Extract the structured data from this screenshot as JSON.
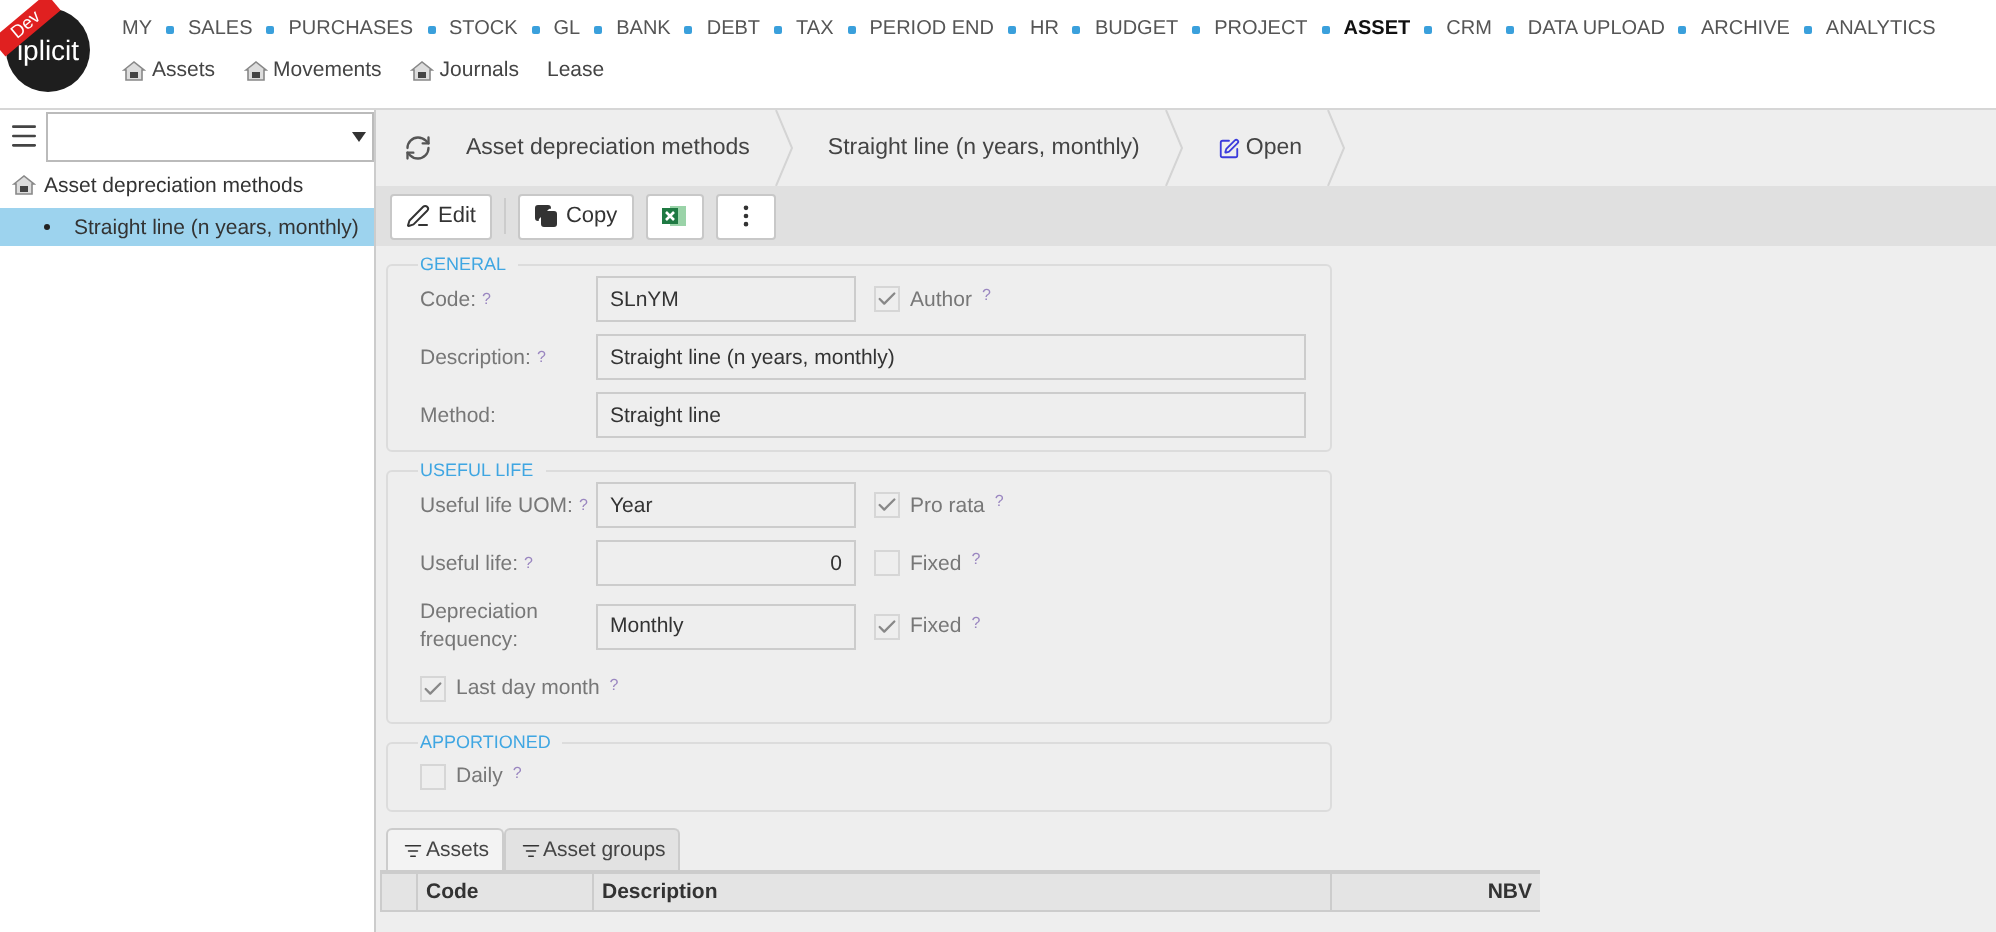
{
  "header": {
    "badge": "Dev",
    "logo": "iplicit",
    "modules": [
      {
        "label": "MY",
        "selected": false
      },
      {
        "label": "SALES",
        "selected": false
      },
      {
        "label": "PURCHASES",
        "selected": false
      },
      {
        "label": "STOCK",
        "selected": false
      },
      {
        "label": "GL",
        "selected": false
      },
      {
        "label": "BANK",
        "selected": false
      },
      {
        "label": "DEBT",
        "selected": false
      },
      {
        "label": "TAX",
        "selected": false
      },
      {
        "label": "PERIOD END",
        "selected": false
      },
      {
        "label": "HR",
        "selected": false
      },
      {
        "label": "BUDGET",
        "selected": false
      },
      {
        "label": "PROJECT",
        "selected": false
      },
      {
        "label": "ASSET",
        "selected": true
      },
      {
        "label": "CRM",
        "selected": false
      },
      {
        "label": "DATA UPLOAD",
        "selected": false
      },
      {
        "label": "ARCHIVE",
        "selected": false
      },
      {
        "label": "ANALYTICS",
        "selected": false
      }
    ],
    "subnav": [
      {
        "label": "Assets",
        "kind": "icon"
      },
      {
        "label": "Movements",
        "kind": "icon"
      },
      {
        "label": "Journals",
        "kind": "icon"
      },
      {
        "label": "Lease",
        "kind": "plain"
      }
    ]
  },
  "sidebar": {
    "tree": [
      {
        "label": "Asset depreciation methods",
        "selected": false,
        "children": [
          {
            "label": "Straight line (n years, monthly)",
            "selected": true
          }
        ]
      }
    ]
  },
  "breadcrumb": [
    {
      "label": "Asset depreciation methods",
      "kind": "text"
    },
    {
      "label": "Straight line (n years, monthly)",
      "kind": "text"
    },
    {
      "label": "Open",
      "kind": "link"
    }
  ],
  "toolbar": [
    {
      "kind": "edit",
      "label": "Edit"
    },
    {
      "kind": "copy",
      "label": "Copy"
    },
    {
      "kind": "excel"
    },
    {
      "kind": "more"
    }
  ],
  "sections": [
    {
      "title": "GENERAL",
      "rows": [
        {
          "label": "Code:",
          "help": "?",
          "field": {
            "value": "SLnYM",
            "wide": false,
            "kind": "text"
          },
          "checkbox": {
            "label": "Author",
            "checked": true,
            "help": "?"
          }
        },
        {
          "label": "Description:",
          "help": "?",
          "field": {
            "value": "Straight line (n years, monthly)",
            "wide": true,
            "kind": "text"
          }
        },
        {
          "label": "Method:",
          "field": {
            "value": "Straight line",
            "wide": true,
            "kind": "text"
          }
        }
      ]
    },
    {
      "title": "USEFUL LIFE",
      "rows": [
        {
          "label": "Useful life UOM:",
          "help": "?",
          "field": {
            "value": "Year",
            "wide": false,
            "kind": "text"
          },
          "checkbox": {
            "label": "Pro rata",
            "checked": true,
            "help": "?"
          }
        },
        {
          "label": "Useful life:",
          "help": "?",
          "field": {
            "value": "0",
            "wide": false,
            "kind": "number"
          },
          "checkbox": {
            "label": "Fixed",
            "checked": false,
            "help": "?"
          }
        },
        {
          "label": "Depreciation frequency:",
          "field": {
            "value": "Monthly",
            "wide": false,
            "kind": "text"
          },
          "checkbox": {
            "label": "Fixed",
            "checked": true,
            "help": "?"
          }
        },
        {
          "checkbox": {
            "label": "Last day month",
            "checked": true,
            "help": "?"
          }
        }
      ]
    },
    {
      "title": "APPORTIONED",
      "rows": [
        {
          "checkbox": {
            "label": "Daily",
            "checked": false,
            "help": "?"
          }
        }
      ]
    }
  ],
  "tabs": [
    {
      "label": "Assets",
      "selected": true
    },
    {
      "label": "Asset groups",
      "selected": false
    }
  ],
  "table": {
    "columns": [
      {
        "label": "Code",
        "kind": "text"
      },
      {
        "label": "Description",
        "kind": "text"
      },
      {
        "label": "NBV",
        "kind": "number"
      }
    ]
  }
}
